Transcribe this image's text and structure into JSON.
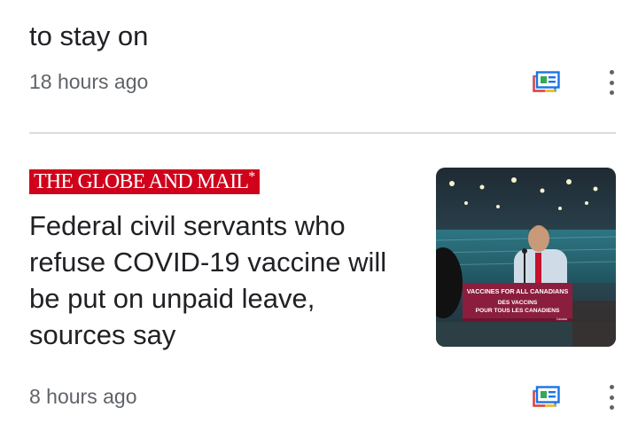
{
  "previous_card": {
    "title_tail": "to stay on",
    "timestamp": "18 hours ago"
  },
  "article": {
    "source": "THE GLOBE AND MAIL",
    "source_mark": "*",
    "headline": "Federal civil servants who refuse COVID-19 vaccine will be put on unpaid leave, sources say",
    "timestamp": "8 hours ago",
    "thumbnail_sign": {
      "line1": "VACCINES FOR ALL CANADIANS",
      "line2": "DES VACCINS",
      "line3": "POUR TOUS LES CANADIENS",
      "small": "Canada"
    }
  },
  "icons": {
    "full_coverage": "full-coverage-icon",
    "more": "more-vert-icon"
  },
  "colors": {
    "globe_red": "#d0021b",
    "text_primary": "#202124",
    "text_secondary": "#5f6368",
    "divider": "#dadce0",
    "podium": "#8b1e3f"
  }
}
